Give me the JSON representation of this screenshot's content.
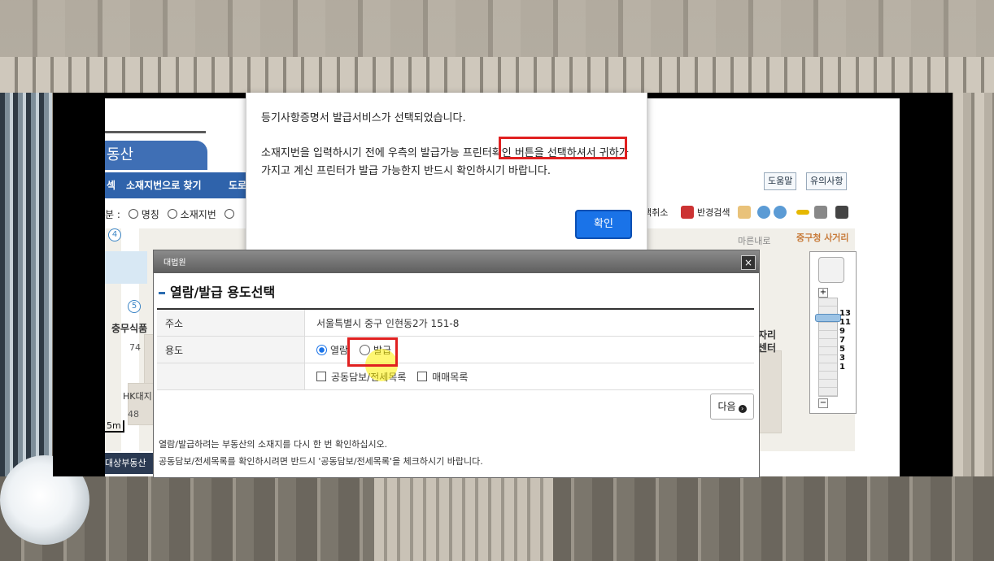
{
  "background": {
    "description_color": "#8a8478"
  },
  "page": {
    "tab_title": "동산",
    "tabs": [
      "섹",
      "소재지번으로 찾기",
      "도로"
    ],
    "search_kind_label": "분 :",
    "search_kind_options": [
      "명칭",
      "소재지번"
    ],
    "help_buttons": [
      "도움말",
      "유의사항"
    ],
    "toolbar": [
      "택취소",
      "반경검색"
    ]
  },
  "map": {
    "labels": {
      "food": "충무식품",
      "num74": "74",
      "hk": "HK대지",
      "num48": "48",
      "east_road": "마른내로",
      "junction": "중구청 사거리",
      "center1": "자리",
      "center2": "센터"
    },
    "circle_numbers": [
      "4",
      "5",
      "5"
    ],
    "scale": "5m",
    "bottom_strip": "대상부동산",
    "zoom_levels": [
      "13",
      "11",
      "9",
      "7",
      "5",
      "3",
      "1"
    ]
  },
  "alert": {
    "message_line1": "등기사항증명서 발급서비스가 선택되었습니다.",
    "message_line2": "소재지번을 입력하시기 전에 우측의 발급가능 프린터확인 버튼을 선택하셔서 귀하가 가지고 계신 프린터가 발급 가능한지 반드시 확인하시기 바랍니다.",
    "ok_button": "확인"
  },
  "dialog": {
    "logo": "대법원",
    "close": "×",
    "title": "열람/발급 용도선택",
    "address_label": "주소",
    "address_value": "서울특별시 중구 인현동2가 151-8",
    "purpose_label": "용도",
    "purpose_options": [
      "열람",
      "발급"
    ],
    "purpose_selected": "열람",
    "checkbox_options": [
      "공동담보/전세목록",
      "매매목록"
    ],
    "next_button": "다음",
    "next_arrow": "›",
    "notes": [
      "열람/발급하려는 부동산의 소재지를 다시 한 번 확인하십시오.",
      "공동담보/전세목록를 확인하시려면 반드시 '공동담보/전세목록'을 체크하시기 바랍니다."
    ]
  }
}
